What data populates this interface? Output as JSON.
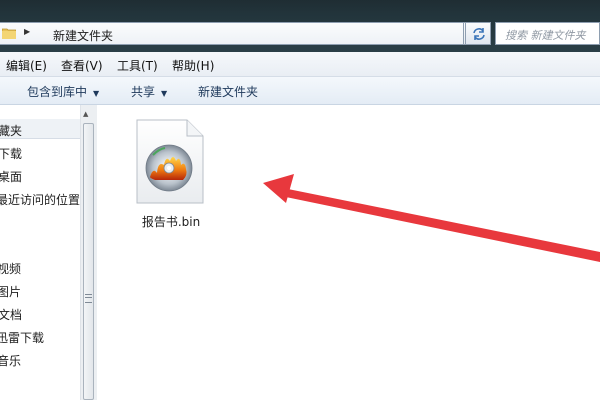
{
  "address_bar": {
    "path": "新建文件夹",
    "folder_icon": "folder-icon",
    "refresh_icon": "refresh-icon"
  },
  "search": {
    "placeholder": "搜索 新建文件夹"
  },
  "menu": {
    "items": [
      "编辑(E)",
      "查看(V)",
      "工具(T)",
      "帮助(H)"
    ]
  },
  "toolbar": {
    "include_in_library": "包含到库中",
    "share": "共享",
    "new_folder": "新建文件夹"
  },
  "nav": {
    "items": [
      "藏夹",
      "下载",
      "桌面",
      "最近访问的位置",
      "视频",
      "图片",
      "文档",
      "迅雷下载",
      "音乐"
    ]
  },
  "content": {
    "file_name": "报告书.bin",
    "file_icon": "disc-image-file-icon"
  },
  "colors": {
    "annotation_arrow": "#e8383d",
    "toolbar_text": "#1e395b"
  }
}
